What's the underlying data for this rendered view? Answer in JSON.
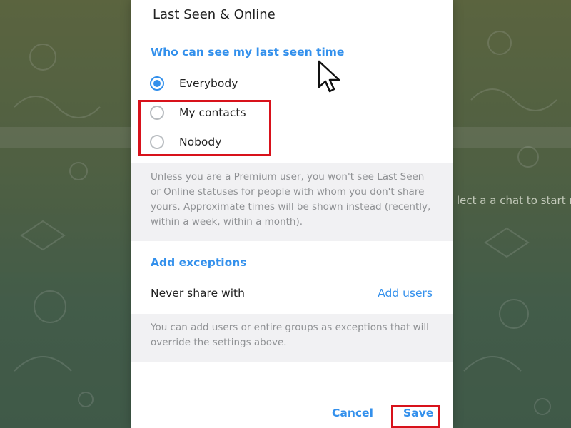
{
  "background": {
    "hint_text": "lect a a chat to start m"
  },
  "dialog": {
    "title": "Last Seen & Online",
    "last_seen_section": {
      "header": "Who can see my last seen time",
      "options": [
        {
          "label": "Everybody",
          "selected": true
        },
        {
          "label": "My contacts",
          "selected": false
        },
        {
          "label": "Nobody",
          "selected": false
        }
      ],
      "info": "Unless you are a Premium user, you won't see Last Seen or Online statuses for people with whom you don't share yours. Approximate times will be shown instead (recently, within a week, within a month)."
    },
    "exceptions_section": {
      "header": "Add exceptions",
      "never_share_label": "Never share with",
      "add_users_label": "Add users",
      "info": "You can add users or entire groups as exceptions that will override the settings above."
    },
    "buttons": {
      "cancel": "Cancel",
      "save": "Save"
    }
  },
  "colors": {
    "accent": "#3390ec",
    "highlight": "#d8121b",
    "info_bg": "#f1f1f3"
  }
}
